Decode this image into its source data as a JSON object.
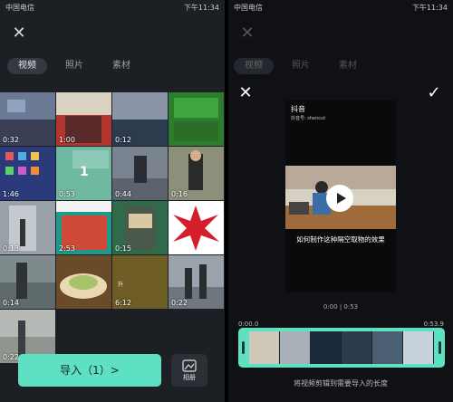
{
  "left": {
    "status": {
      "carrier": "中国电信",
      "time": "下午11:34"
    },
    "tabs": [
      {
        "label": "视频",
        "active": true
      },
      {
        "label": "照片",
        "active": false
      },
      {
        "label": "素材",
        "active": false
      }
    ],
    "grid": [
      [
        "0:32",
        "1:00",
        "0:12",
        ""
      ],
      [
        "1:46",
        "0:53",
        "0:44",
        "0:16"
      ],
      [
        "0:13",
        "2:53",
        "0:15",
        ""
      ],
      [
        "0:14",
        "",
        "6:12",
        "0:22"
      ],
      [
        "0:22",
        "",
        "",
        ""
      ]
    ],
    "selected_badge": "1",
    "import_label": "导入（1）>",
    "album_label": "相册"
  },
  "right": {
    "status": {
      "carrier": "中国电信",
      "time": "下午11:34"
    },
    "tabs": [
      {
        "label": "视频"
      },
      {
        "label": "照片"
      },
      {
        "label": "素材"
      }
    ],
    "video": {
      "app_name": "抖音",
      "account": "抖音号: shencut",
      "caption": "如何制作这种隔空取物的效果",
      "time": "0:00 | 0:53"
    },
    "trim": {
      "start": "0:00.0",
      "end": "0:53.9",
      "hint": "将视频剪辑到需要导入的长度"
    }
  },
  "colors": {
    "accent": "#5ee0c2",
    "panel": "#1c1f24"
  }
}
